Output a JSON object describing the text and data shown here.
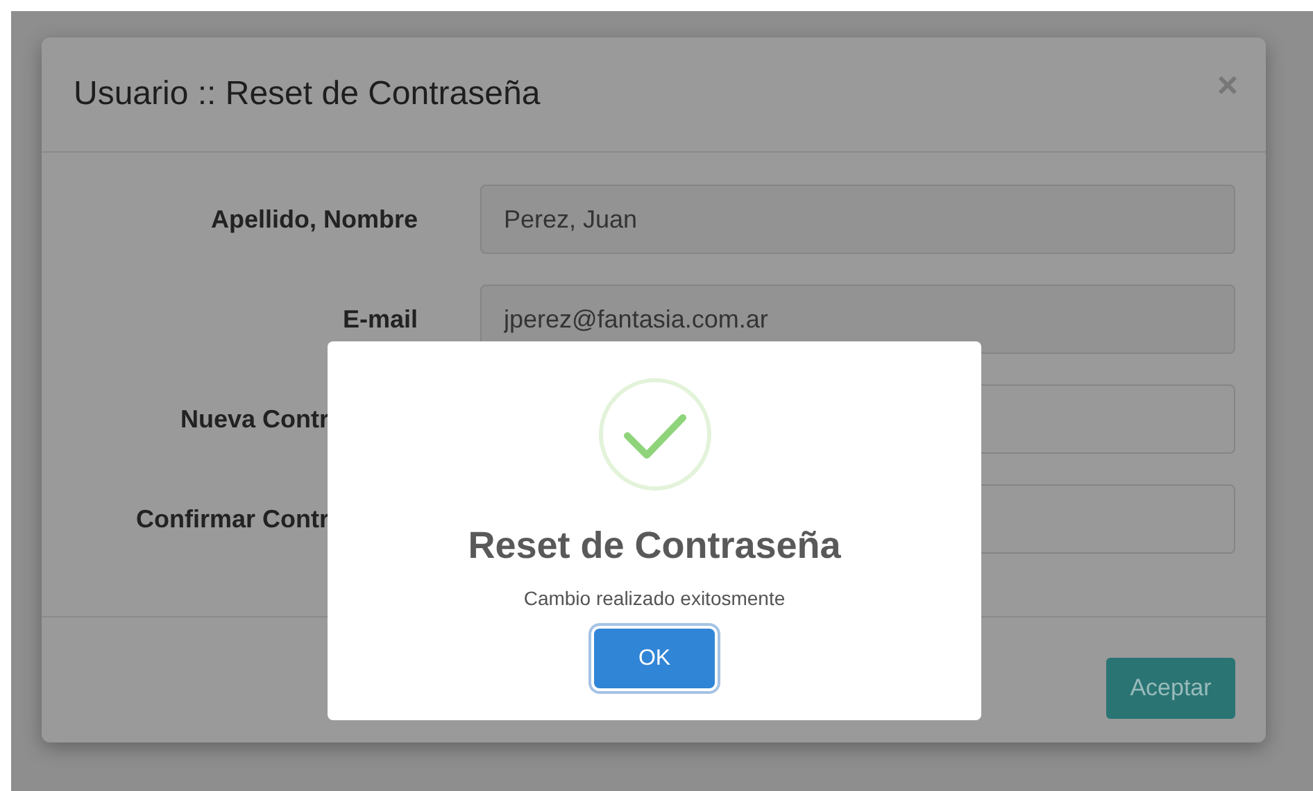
{
  "dialog": {
    "title": "Usuario :: Reset de Contraseña",
    "close": "×",
    "fields": [
      {
        "label": "Apellido, Nombre",
        "value": "Perez, Juan",
        "readonly": true,
        "label_covered": false
      },
      {
        "label": "E-mail",
        "value": "jperez@fantasia.com.ar",
        "readonly": true,
        "label_covered": false
      },
      {
        "label": "Nueva Contr",
        "readonly": false,
        "label_covered": true
      },
      {
        "label": "Confirmar Contr",
        "readonly": false,
        "label_covered": true
      }
    ],
    "button": "Aceptar"
  },
  "alert": {
    "title": "Reset de Contraseña",
    "message": "Cambio realizado exitosmente",
    "button": "OK"
  }
}
